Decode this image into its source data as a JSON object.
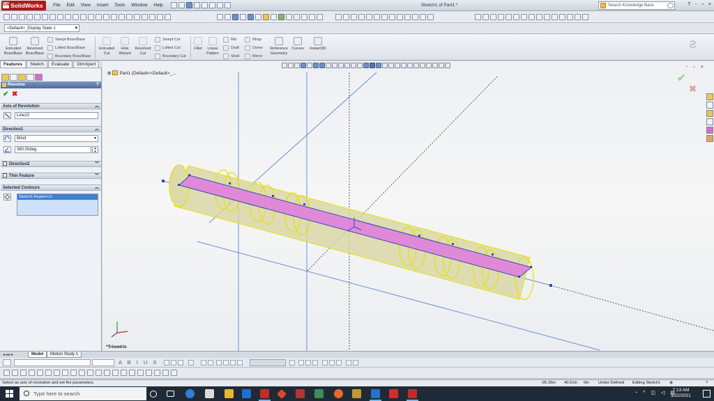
{
  "app": {
    "name": "SolidWorks",
    "doc_title": "Sketch1 of Part1 *"
  },
  "menu": [
    "File",
    "Edit",
    "View",
    "Insert",
    "Tools",
    "Window",
    "Help"
  ],
  "search_placeholder": "Search Knowledge Base",
  "window_controls": [
    "?",
    "-",
    "▫",
    "×"
  ],
  "configuration": "<Default>_Display State 1",
  "commands": {
    "extruded_boss": "Extruded Boss/Base",
    "revolved_boss": "Revolved Boss/Base",
    "swept_boss": "Swept Boss/Base",
    "lofted_boss": "Lofted Boss/Base",
    "boundary_boss": "Boundary Boss/Base",
    "extruded_cut": "Extruded Cut",
    "hole_wizard": "Hole Wizard",
    "revolved_cut": "Revolved Cut",
    "swept_cut": "Swept Cut",
    "lofted_cut": "Lofted Cut",
    "boundary_cut": "Boundary Cut",
    "fillet": "Fillet",
    "linear_pattern": "Linear Pattern",
    "rib": "Rib",
    "draft": "Draft",
    "shell": "Shell",
    "wrap": "Wrap",
    "dome": "Dome",
    "mirror": "Mirror",
    "reference_geometry": "Reference Geometry",
    "curves": "Curves",
    "instant3d": "Instant3D"
  },
  "tabs": [
    "Features",
    "Sketch",
    "Evaluate",
    "DimXpert"
  ],
  "property_manager": {
    "title": "Revolve",
    "ok": "✔",
    "cancel": "✖",
    "axis_section": "Axis of Revolution",
    "axis_value": "Line23",
    "direction1_section": "Direction1",
    "direction1_type": "Blind",
    "direction1_angle": "360.00deg",
    "direction2_section": "Direction2",
    "thin_section": "Thin Feature",
    "contours_section": "Selected Contours",
    "contour_item": "Sketch1-Region<1>"
  },
  "tree_label": "Part1 (Default<<Default>_...",
  "view_label": "*Trimetric",
  "bottom_tabs": [
    "Model",
    "Motion Study 1"
  ],
  "status": {
    "message": "Select an axis of revolution and set the parameters.",
    "x": "-95.36in",
    "y": "40.51in",
    "z": "0in",
    "state": "Under Defined",
    "mode": "Editing Sketch1"
  },
  "taskbar": {
    "search": "Type here to search",
    "time": "7:13 AM",
    "date": "3/22/2021"
  }
}
